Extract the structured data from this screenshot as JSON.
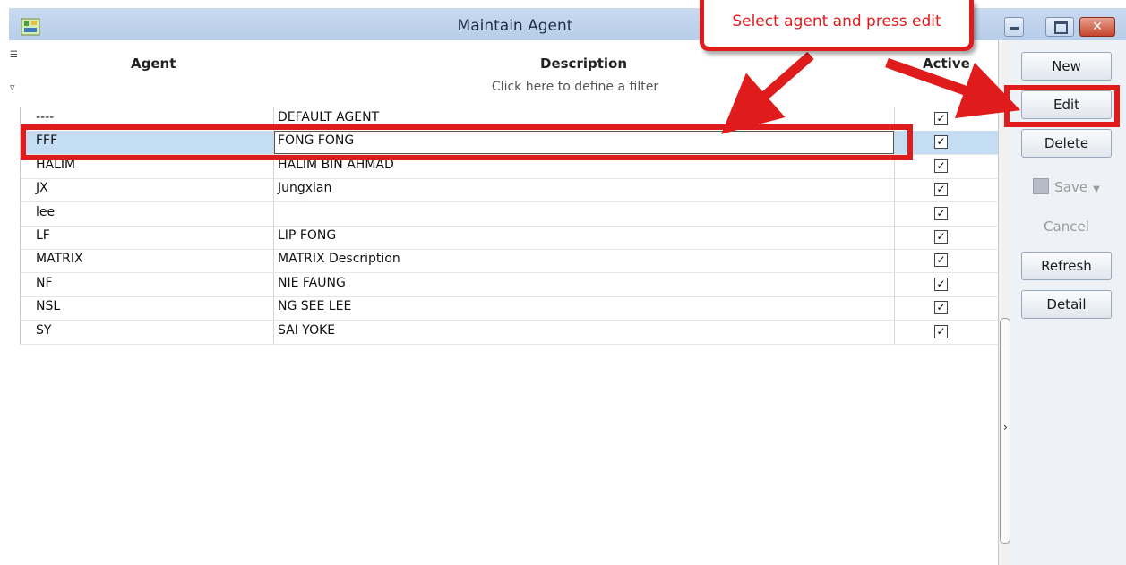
{
  "window": {
    "title": "Maintain Agent"
  },
  "grid": {
    "columns": {
      "agent": "Agent",
      "description": "Description",
      "active": "Active"
    },
    "filter_hint": "Click here to define a filter",
    "rows": [
      {
        "agent": "----",
        "description": "DEFAULT AGENT",
        "active": true
      },
      {
        "agent": "FFF",
        "description": "FONG FONG",
        "active": true,
        "selected": true
      },
      {
        "agent": "HALIM",
        "description": "HALIM BIN AHMAD",
        "active": true
      },
      {
        "agent": "JX",
        "description": "Jungxian",
        "active": true
      },
      {
        "agent": "lee",
        "description": "",
        "active": true
      },
      {
        "agent": "LF",
        "description": "LIP FONG",
        "active": true
      },
      {
        "agent": "MATRIX",
        "description": "MATRIX Description",
        "active": true
      },
      {
        "agent": "NF",
        "description": "NIE FAUNG",
        "active": true
      },
      {
        "agent": "NSL",
        "description": "NG SEE LEE",
        "active": true
      },
      {
        "agent": "SY",
        "description": "SAI YOKE",
        "active": true
      }
    ]
  },
  "panel": {
    "new": "New",
    "edit": "Edit",
    "delete": "Delete",
    "save": "Save",
    "cancel": "Cancel",
    "refresh": "Refresh",
    "detail": "Detail"
  },
  "annotation": {
    "callout": "Select agent and press edit",
    "color": "#e01b1b"
  },
  "icons": {
    "app": "app-icon",
    "minimize": "minimize-icon",
    "maximize": "maximize-icon",
    "close": "close-icon",
    "column_chooser": "column-chooser-icon",
    "filter": "filter-icon",
    "save": "save-icon"
  }
}
